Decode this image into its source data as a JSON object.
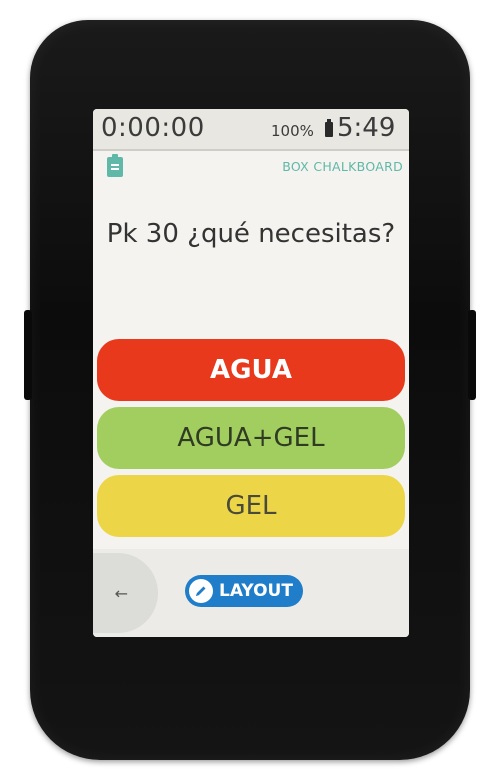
{
  "status": {
    "timer": "0:00:00",
    "battery": "100%",
    "clock": "5:49"
  },
  "app": {
    "label": "BOX CHALKBOARD",
    "icon": "clipboard-icon"
  },
  "question": "Pk 30 ¿qué necesitas?",
  "answers": [
    {
      "label": "AGUA",
      "color": "#e8391c"
    },
    {
      "label": "AGUA+GEL",
      "color": "#a2cd5f"
    },
    {
      "label": "GEL",
      "color": "#ecd648"
    }
  ],
  "bottom": {
    "back_label": "←",
    "layout_label": "LAYOUT",
    "layout_color": "#1f7dc9"
  }
}
